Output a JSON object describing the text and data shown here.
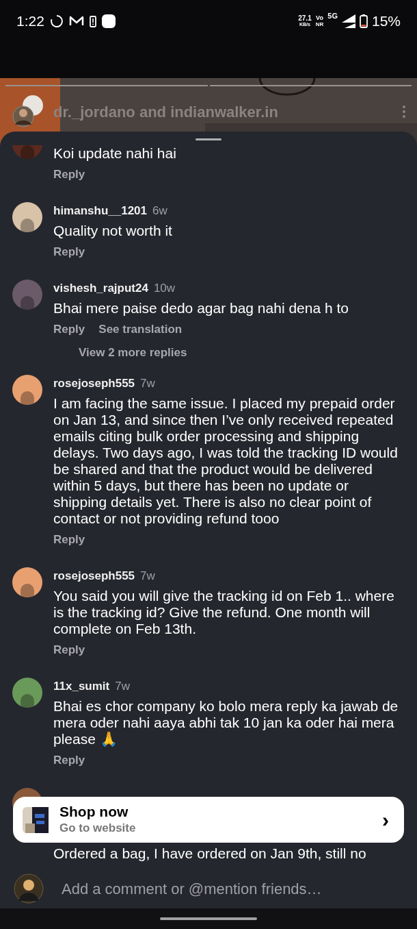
{
  "status_bar": {
    "time": "1:22",
    "net_speed": "27.1",
    "net_unit": "KB/s",
    "volte": "Vo",
    "volte_sub": "NR",
    "network": "5G",
    "battery": "15%"
  },
  "story_header": {
    "title": "dr._jordano and indianwalker.in"
  },
  "comments": [
    {
      "text": "Koi update nahi hai",
      "actions": [
        "Reply"
      ]
    },
    {
      "username": "himanshu__1201",
      "time": "6w",
      "text": "Quality not worth it",
      "actions": [
        "Reply"
      ]
    },
    {
      "username": "vishesh_rajput24",
      "time": "10w",
      "text": "Bhai mere paise dedo agar bag nahi dena h to",
      "actions": [
        "Reply",
        "See translation"
      ],
      "more_replies": "View 2 more replies"
    },
    {
      "username": "rosejoseph555",
      "time": "7w",
      "text": "I am facing the same issue. I placed my prepaid order on Jan 13, and since then I’ve only received repeated emails citing bulk order processing and shipping delays. Two days ago, I was told the tracking ID would be shared and that the product would be delivered within 5 days, but there has been no update or shipping details yet. There is also no clear point of contact or not providing refund tooo",
      "actions": [
        "Reply"
      ]
    },
    {
      "username": "rosejoseph555",
      "time": "7w",
      "text": "You said you will give the tracking id on Feb 1.. where is the tracking id? Give the refund. One month will complete on Feb 13th.",
      "actions": [
        "Reply"
      ]
    },
    {
      "username": "11x_sumit",
      "time": "7w",
      "text": "Bhai es chor company ko bolo mera reply ka jawab de mera oder nahi aaya abhi tak 10 jan ka oder hai mera please 🙏",
      "actions": [
        "Reply"
      ]
    },
    {
      "text": "Ordered a bag, I have ordered on Jan 9th, still no"
    }
  ],
  "shop_card": {
    "title": "Shop now",
    "subtitle": "Go to website",
    "chevron": "›"
  },
  "composer": {
    "placeholder": "Add a comment or @mention friends…"
  }
}
